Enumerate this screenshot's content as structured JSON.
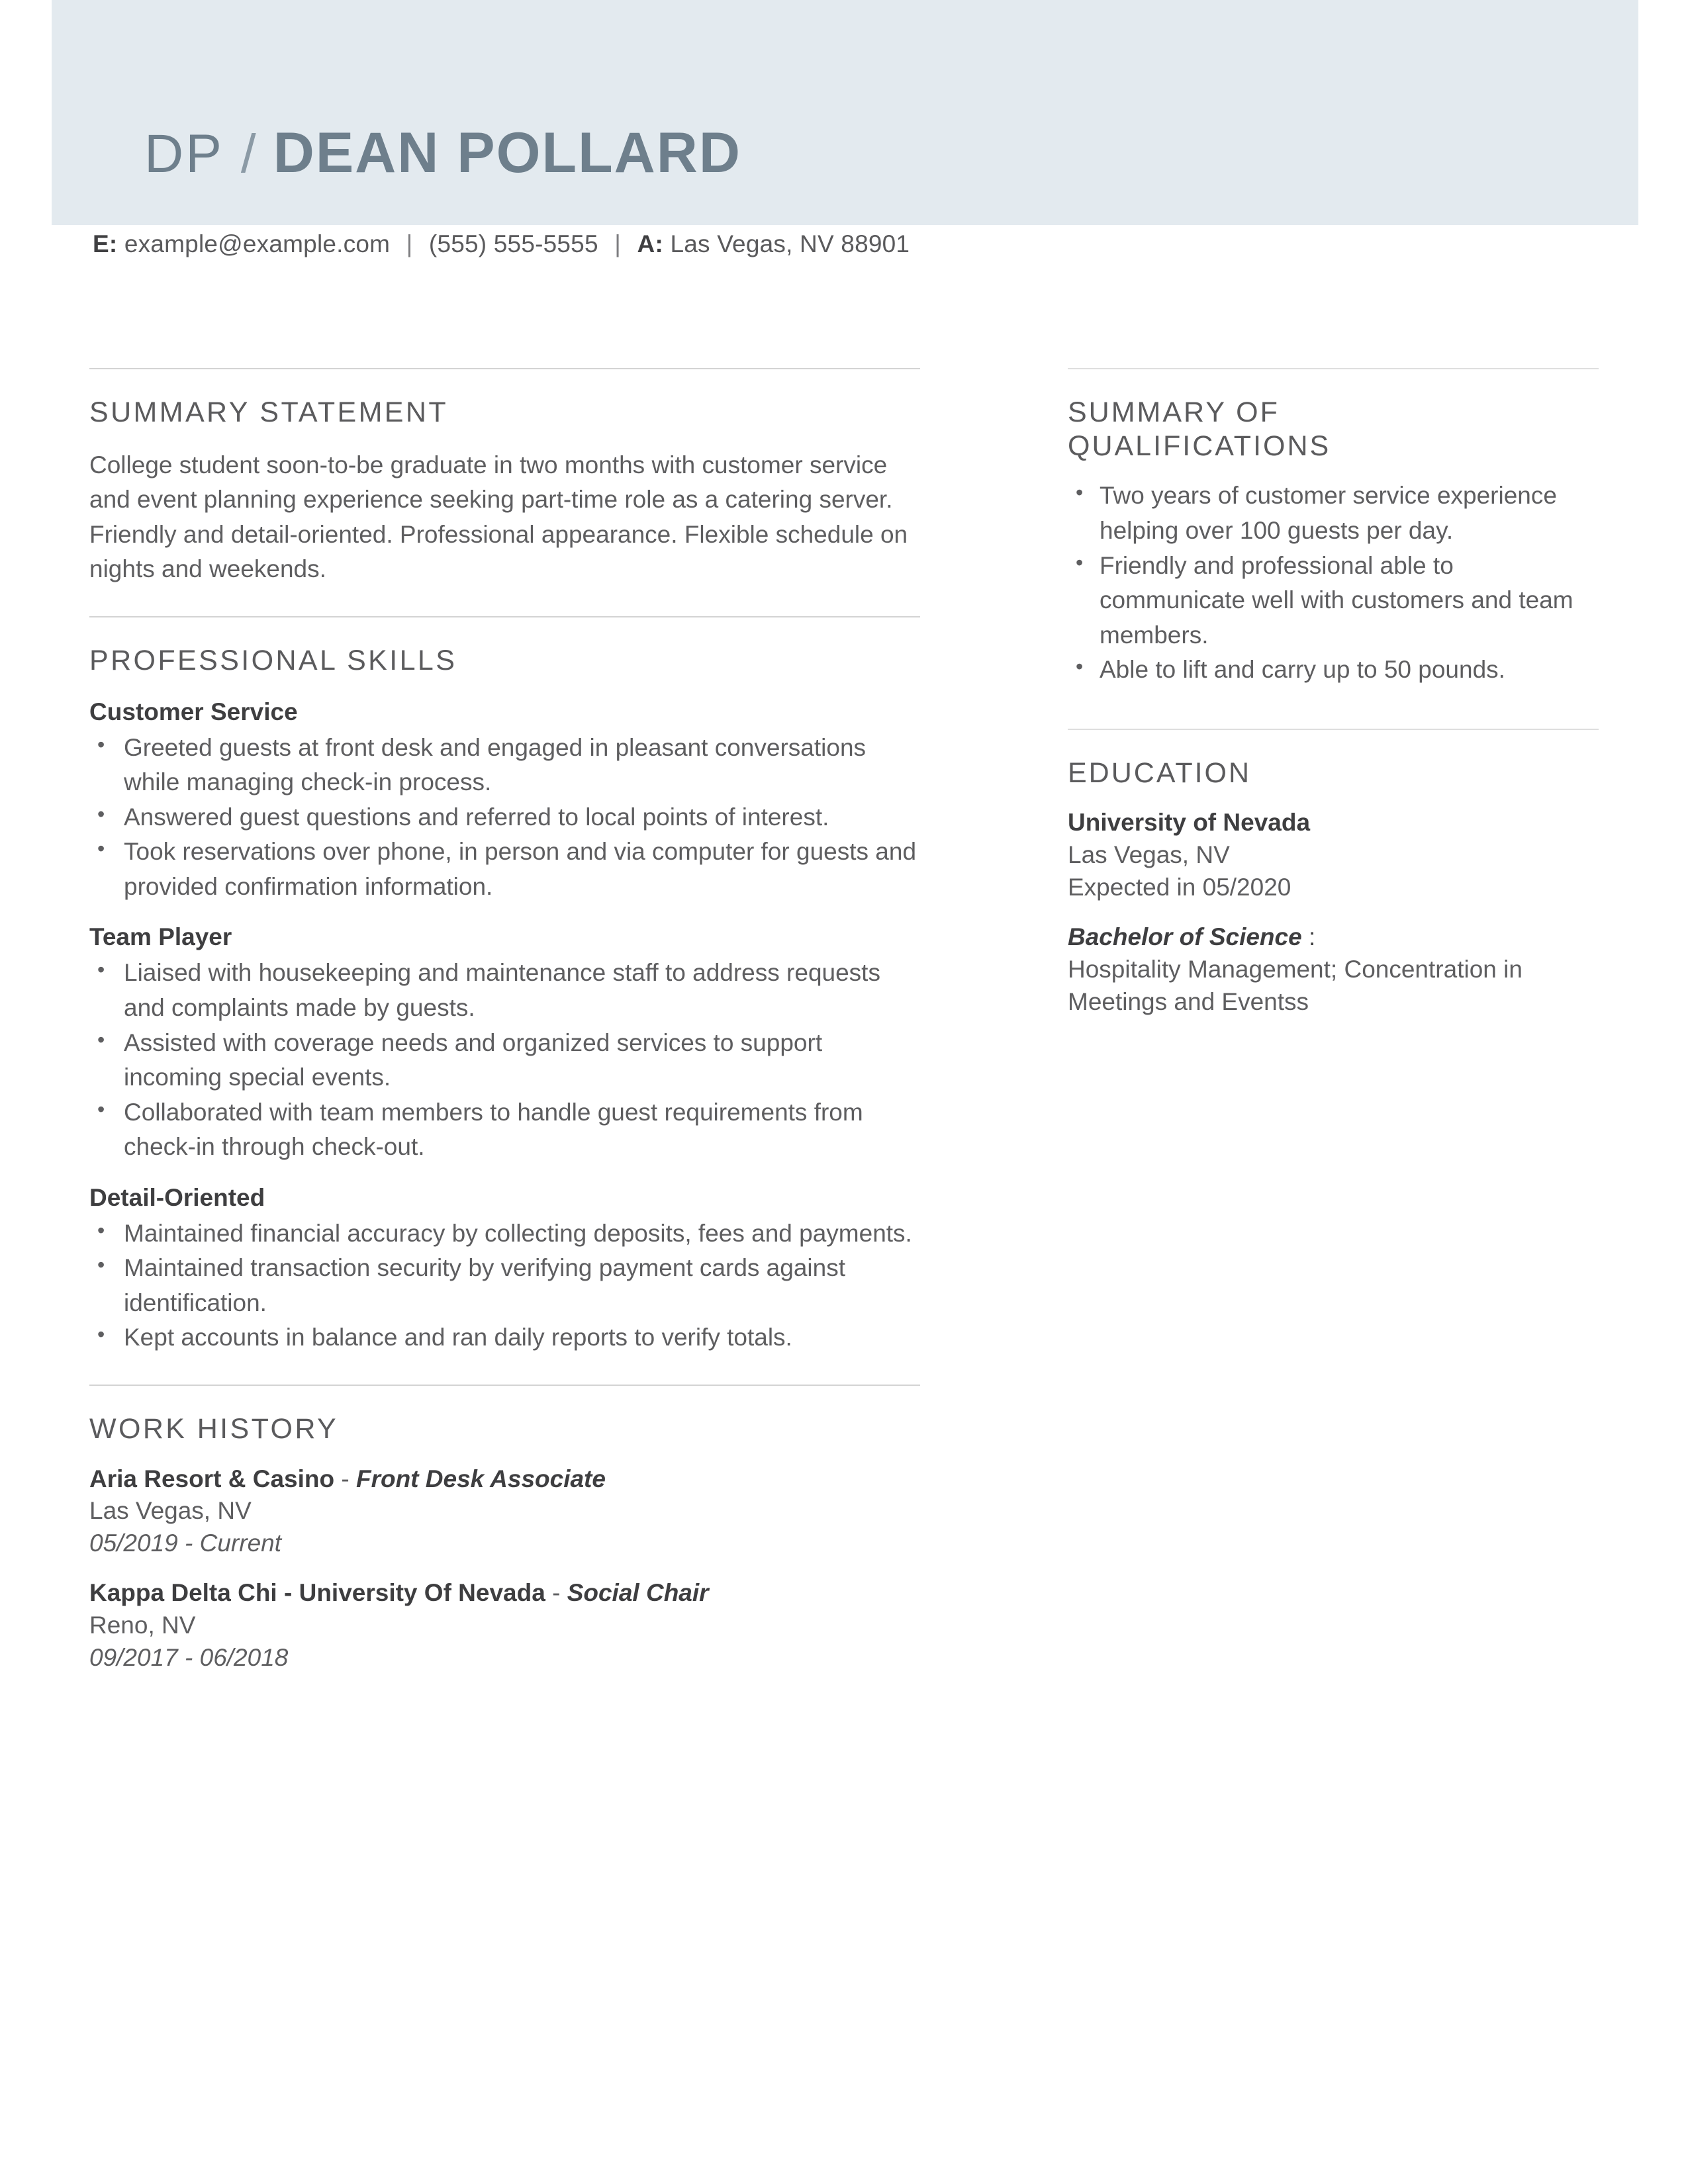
{
  "header": {
    "initials": "DP",
    "slash": "/",
    "full_name": "DEAN POLLARD",
    "banner_color": "#e3eaef",
    "name_color": "#6e7f8c"
  },
  "contact": {
    "email_label": "E:",
    "email": "example@example.com",
    "sep1": "|",
    "phone": "(555) 555-5555",
    "sep2": "|",
    "address_label": "A:",
    "address": "Las Vegas, NV 88901"
  },
  "left_column": {
    "summary_statement": {
      "title": "SUMMARY STATEMENT",
      "text": "College student soon-to-be graduate in two months with customer service and event planning experience seeking part-time role as a catering server. Friendly and detail-oriented. Professional appearance. Flexible schedule on nights and weekends."
    },
    "professional_skills": {
      "title": "PROFESSIONAL SKILLS",
      "groups": [
        {
          "subhead": "Customer Service",
          "bullets": [
            "Greeted guests at front desk and engaged in pleasant conversations while managing check-in process.",
            "Answered guest questions and referred to local points of interest.",
            "Took reservations over phone, in person and via computer for guests and provided confirmation information."
          ]
        },
        {
          "subhead": "Team Player",
          "bullets": [
            "Liaised with housekeeping and maintenance staff to address requests and complaints made by guests.",
            "Assisted with coverage needs and organized services to support incoming special events.",
            "Collaborated with team members to handle guest requirements from check-in through check-out."
          ]
        },
        {
          "subhead": "Detail-Oriented",
          "bullets": [
            "Maintained financial accuracy by collecting deposits, fees and payments.",
            "Maintained transaction security by verifying payment cards against identification.",
            "Kept accounts in balance and ran daily reports to verify totals."
          ]
        }
      ]
    },
    "work_history": {
      "title": "WORK HISTORY",
      "entries": [
        {
          "organization": "Aria Resort & Casino",
          "dash": " - ",
          "role": "Front Desk Associate",
          "location": "Las Vegas, NV",
          "dates": "05/2019 - Current"
        },
        {
          "organization": "Kappa Delta Chi - University Of Nevada",
          "dash": " - ",
          "role": "Social Chair",
          "location": "Reno, NV",
          "dates": "09/2017 - 06/2018"
        }
      ]
    }
  },
  "right_column": {
    "qualifications": {
      "title_line1": "SUMMARY OF",
      "title_line2": "QUALIFICATIONS",
      "bullets": [
        "Two years of customer service experience helping over 100 guests per day.",
        "Friendly and professional able to communicate well with customers and team members.",
        "Able to lift and carry up to 50 pounds."
      ]
    },
    "education": {
      "title": "EDUCATION",
      "school": "University of Nevada",
      "location": "Las Vegas, NV",
      "expected": "Expected in 05/2020",
      "degree": "Bachelor of Science",
      "degree_colon": " :",
      "major": "Hospitality Management; Concentration in Meetings and Eventss"
    }
  }
}
